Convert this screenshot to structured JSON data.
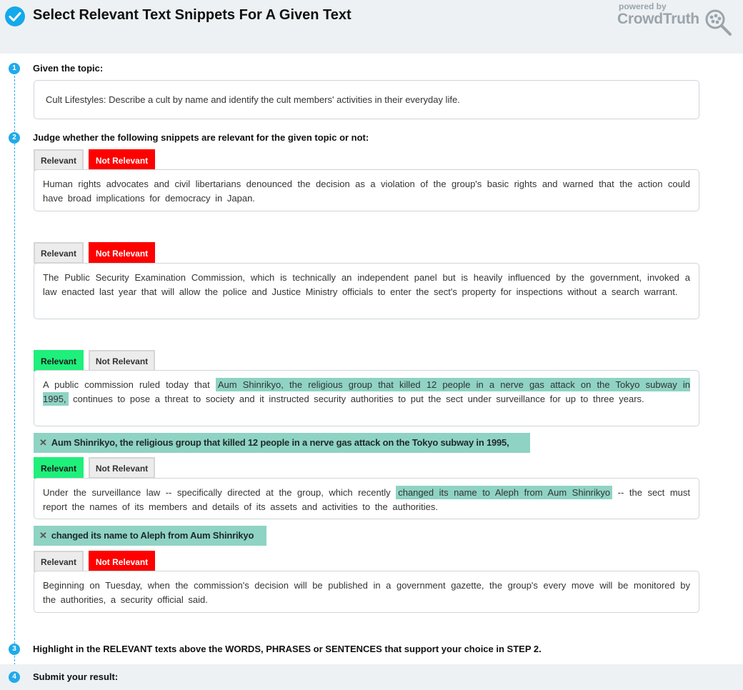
{
  "header": {
    "title": "Select Relevant Text Snippets For A Given Text",
    "logo_small": "powered by",
    "logo_big": "CrowdTruth"
  },
  "steps": [
    {
      "num": "1",
      "label": "Given the topic:"
    },
    {
      "num": "2",
      "label": "Judge whether the following snippets are relevant for the given topic or not:"
    },
    {
      "num": "3",
      "label": "Highlight in the RELEVANT texts above the WORDS, PHRASES or SENTENCES that support your choice in STEP 2."
    },
    {
      "num": "4",
      "label": "Submit your result:"
    }
  ],
  "topic": "Cult Lifestyles: Describe a cult by name and identify the cult members' activities in their everyday life.",
  "buttons": {
    "relevant": "Relevant",
    "not_relevant": "Not Relevant"
  },
  "snippets": [
    {
      "selected": "not_relevant",
      "text": "Human rights advocates and civil libertarians denounced the decision as a violation of the group's basic rights and warned that the action could have broad implications for democracy in Japan."
    },
    {
      "selected": "not_relevant",
      "text": "The Public Security Examination Commission, which is technically an independent panel but is heavily influenced by the government, invoked a law enacted last year that will allow the police and Justice Ministry officials to enter the sect's property for inspections without a search warrant."
    },
    {
      "selected": "relevant",
      "before": "A public commission ruled today that",
      "highlight": "Aum Shinrikyo, the religious group that killed 12 people in a nerve gas attack on the Tokyo subway in 1995,",
      "after": "continues to pose a threat to society and it instructed security authorities to put the sect under surveillance for up to three years.",
      "chip": "Aum Shinrikyo, the religious group that killed 12 people in a nerve gas attack on the Tokyo subway in 1995,"
    },
    {
      "selected": "relevant",
      "before": "Under the surveillance law -- specifically directed at the group, which recently",
      "highlight": "changed its name to Aleph from Aum Shinrikyo",
      "after": "-- the sect must report the names of its members and details of its assets and activities to the authorities.",
      "chip": "changed its name to Aleph from Aum Shinrikyo"
    },
    {
      "selected": "not_relevant",
      "text": "Beginning on Tuesday, when the commission's decision will be published in a government gazette, the group's every move will be monitored by the authorities, a security official said."
    }
  ],
  "colors": {
    "accent": "#22aaea",
    "relevant_on": "#1fef7b",
    "not_relevant_on": "#fe0000",
    "highlight": "#8fd3c4"
  }
}
